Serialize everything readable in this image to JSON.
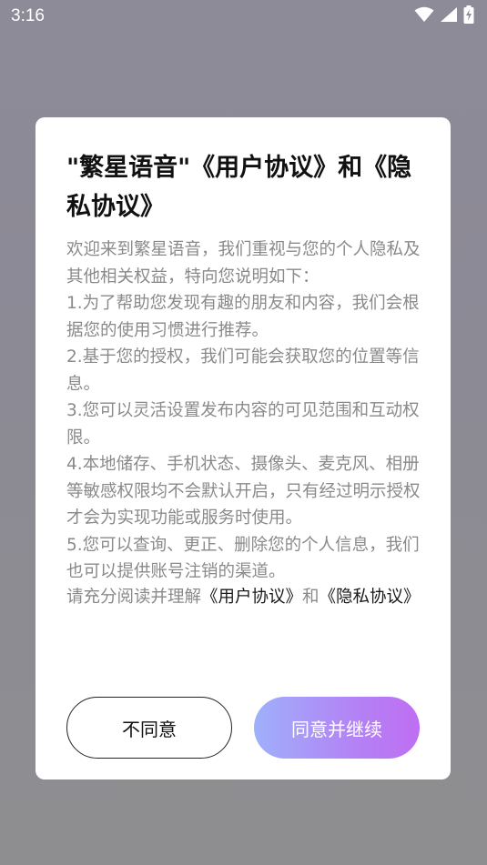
{
  "status_bar": {
    "time": "3:16",
    "icons": [
      "wifi-icon",
      "signal-icon",
      "battery-charging-icon"
    ]
  },
  "dialog": {
    "title": "\"繁星语音\"《用户协议》和《隐私协议》",
    "paragraphs": [
      "欢迎来到繁星语音，我们重视与您的个人隐私及其他相关权益，特向您说明如下：",
      "1.为了帮助您发现有趣的朋友和内容，我们会根据您的使用习惯进行推荐。",
      "2.基于您的授权，我们可能会获取您的位置等信息。",
      "3.您可以灵活设置发布内容的可见范围和互动权限。",
      "4.本地储存、手机状态、摄像头、麦克风、相册等敏感权限均不会默认开启，只有经过明示授权才会为实现功能或服务时使用。",
      "5.您可以查询、更正、删除您的个人信息，我们也可以提供账号注销的渠道。"
    ],
    "read_prompt": "请充分阅读并理解",
    "user_agreement_link": "《用户协议》",
    "and_text": "和",
    "privacy_agreement_link": "《隐私协议》",
    "disagree_label": "不同意",
    "agree_label": "同意并继续"
  },
  "colors": {
    "agree_gradient_start": "#9fb0fb",
    "agree_gradient_end": "#bf6ef2",
    "body_text": "#8a8a8a",
    "overlay": "#8e8b99"
  }
}
